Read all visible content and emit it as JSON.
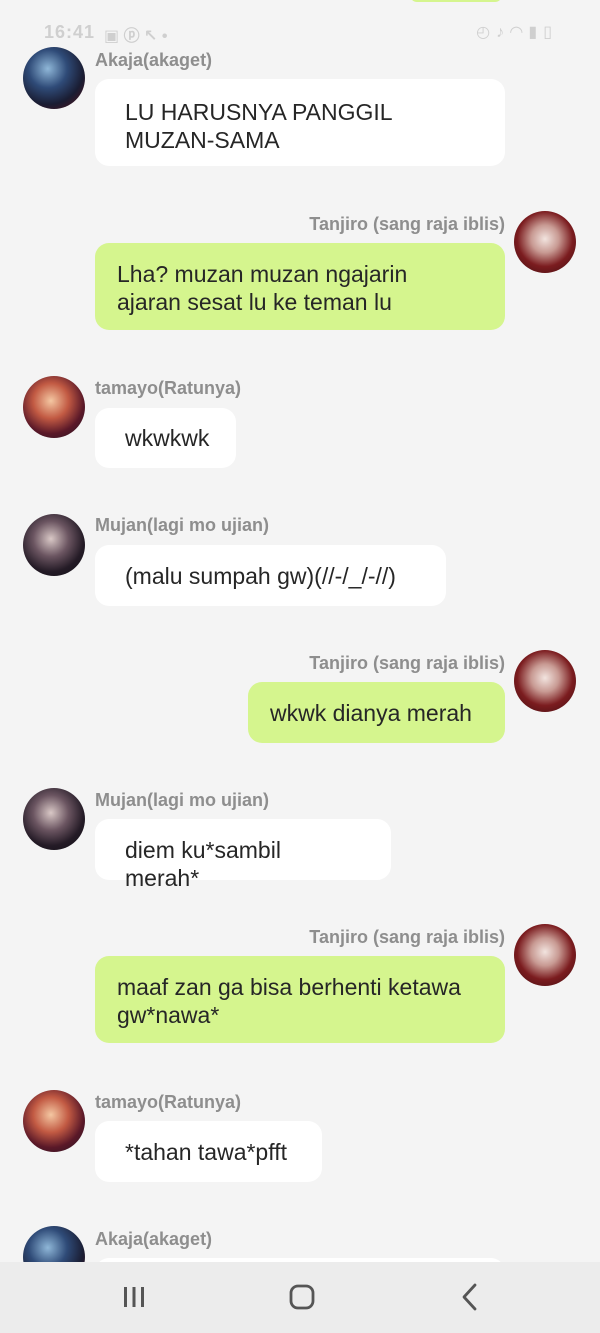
{
  "status_bar": {
    "time": "16:41",
    "left_icons": [
      "gallery-icon",
      "pinterest-icon",
      "missed-call-icon",
      "dot-icon"
    ],
    "right_icons": [
      "alarm-icon",
      "mute-icon",
      "wifi-icon",
      "signal-icon",
      "lock-icon"
    ]
  },
  "chat": {
    "messages": [
      {
        "sender": "Akaja(akaget)",
        "side": "left",
        "avatar": "akaja-avatar",
        "lines": [
          "LU HARUSNYA PANGGIL",
          "MUZAN-SAMA"
        ]
      },
      {
        "sender": "Tanjiro (sang raja iblis)",
        "side": "right",
        "avatar": "tanjiro-avatar",
        "lines": [
          "Lha? muzan muzan ngajarin",
          "ajaran sesat lu ke teman lu"
        ]
      },
      {
        "sender": "tamayo(Ratunya)",
        "side": "left",
        "avatar": "tamayo-avatar",
        "lines": [
          "wkwkwk"
        ]
      },
      {
        "sender": "Mujan(lagi mo ujian)",
        "side": "left",
        "avatar": "mujan-avatar",
        "lines": [
          "(malu sumpah gw)(//-/_/-//)"
        ]
      },
      {
        "sender": "Tanjiro (sang raja iblis)",
        "side": "right",
        "avatar": "tanjiro-avatar",
        "lines": [
          "wkwk dianya merah"
        ]
      },
      {
        "sender": "Mujan(lagi mo ujian)",
        "side": "left",
        "avatar": "mujan-avatar",
        "lines": [
          "diem ku*sambil merah*"
        ]
      },
      {
        "sender": "Tanjiro (sang raja iblis)",
        "side": "right",
        "avatar": "tanjiro-avatar",
        "lines": [
          "maaf zan ga bisa berhenti ketawa",
          "gw*nawa*"
        ]
      },
      {
        "sender": "tamayo(Ratunya)",
        "side": "left",
        "avatar": "tamayo-avatar",
        "lines": [
          "*tahan tawa*pfft"
        ]
      },
      {
        "sender": "Akaja(akaget)",
        "side": "left",
        "avatar": "akaja-avatar",
        "lines": []
      }
    ]
  },
  "navbar": {
    "buttons": [
      "recent-apps-icon",
      "home-icon",
      "back-icon"
    ]
  },
  "colors": {
    "background": "#f4f4f4",
    "incoming_bubble": "#ffffff",
    "outgoing_bubble": "#d5f58e",
    "sender_text": "#8e8e8e",
    "message_text": "#262626"
  }
}
